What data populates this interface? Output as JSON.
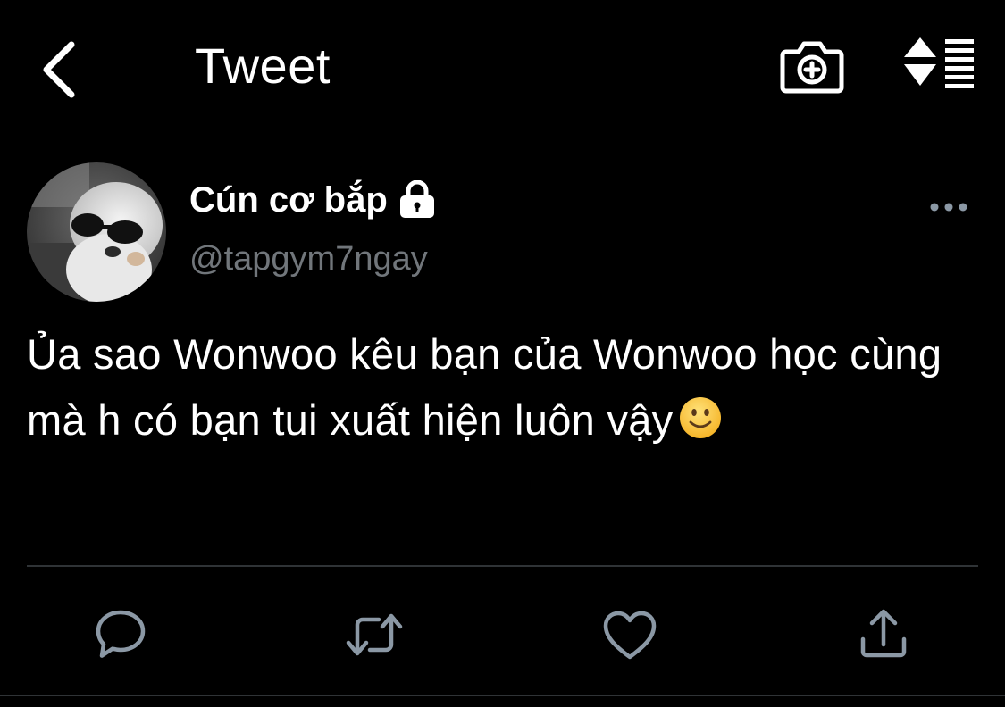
{
  "header": {
    "title": "Tweet",
    "icons": {
      "back": "chevron-left-icon",
      "camera": "camera-add-icon",
      "sort": "sort-icon"
    }
  },
  "tweet": {
    "author": {
      "display_name": "Cún cơ bắp",
      "handle": "@tapgym7ngay",
      "protected_icon": "lock-icon",
      "avatar_icon": "avatar-photo"
    },
    "text": "Ủa sao Wonwoo kêu bạn của Wonwoo học cùng mà h có bạn tui xuất hiện luôn vậy",
    "emoji": "slightly-smiling-face-icon"
  },
  "actions": [
    {
      "name": "reply",
      "icon": "reply-icon"
    },
    {
      "name": "retweet",
      "icon": "retweet-icon"
    },
    {
      "name": "like",
      "icon": "heart-icon"
    },
    {
      "name": "share",
      "icon": "share-icon"
    }
  ],
  "colors": {
    "background": "#000000",
    "text": "#ffffff",
    "secondary_text": "#71767b",
    "icon_secondary": "#8b98a5",
    "divider": "#2f3336"
  }
}
